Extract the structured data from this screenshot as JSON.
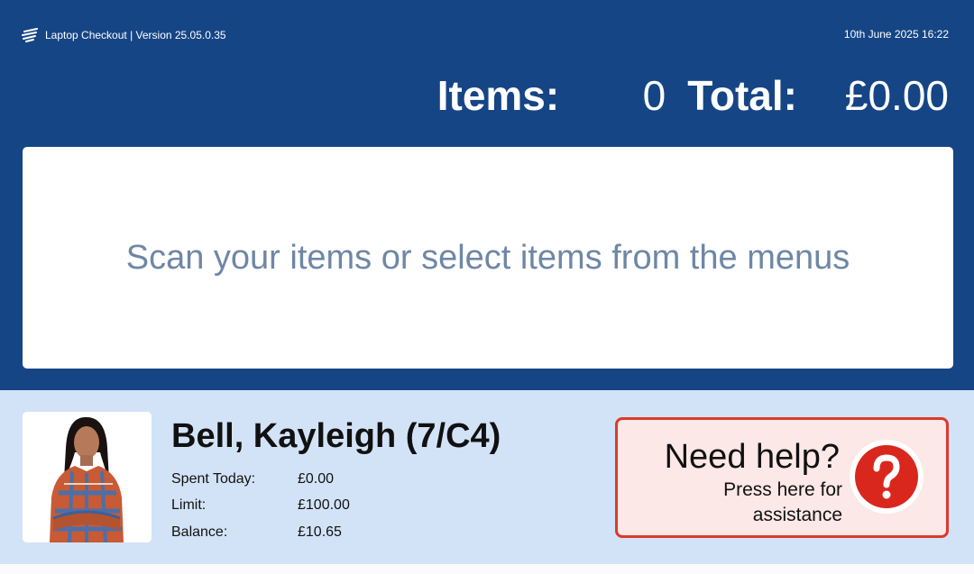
{
  "app": {
    "title": "Laptop Checkout | Version 25.05.0.35",
    "datetime": "10th June 2025 16:22",
    "logo_icon": "wind-lines-logo-icon"
  },
  "summary": {
    "items_label": "Items:",
    "items_count": "0",
    "total_label": "Total:",
    "total_value": "£0.00"
  },
  "scan_panel": {
    "message": "Scan your items or select items from the menus"
  },
  "customer": {
    "name": "Bell, Kayleigh (7/C4)",
    "photo_icon": "customer-photo",
    "spent_today_label": "Spent Today:",
    "spent_today": "£0.00",
    "limit_label": "Limit:",
    "limit": "£100.00",
    "balance_label": "Balance:",
    "balance": "£10.65"
  },
  "help": {
    "title": "Need help?",
    "subtitle": "Press here for assistance",
    "icon": "question-mark-icon"
  },
  "colors": {
    "header_blue": "#164586",
    "customer_band": "#d3e3f7",
    "help_border": "#db3a2c",
    "help_background": "#fce8e6",
    "scan_text": "#6e87a6"
  }
}
